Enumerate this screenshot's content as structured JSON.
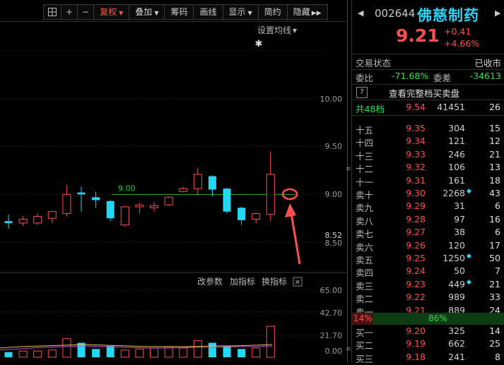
{
  "toolbar": {
    "buttons": [
      "复权",
      "叠加",
      "筹码",
      "画线",
      "显示",
      "简约",
      "隐藏"
    ]
  },
  "chart": {
    "setting_ma": "设置均线",
    "price_axis": [
      "10.00",
      "9.50",
      "9.00",
      "8.50"
    ],
    "current_label": "8.52",
    "line_label": "9.00",
    "sub_links": [
      "改参数",
      "加指标",
      "换指标"
    ],
    "sub_axis": [
      "65.00",
      "42.70",
      "21.70",
      "0.00"
    ]
  },
  "chart_data": {
    "type": "candlestick",
    "price_range": [
      8.25,
      10.25
    ],
    "reference_line": 9.0,
    "candles": [
      {
        "o": 8.7,
        "c": 8.72,
        "h": 8.79,
        "l": 8.64,
        "up": false
      },
      {
        "o": 8.7,
        "c": 8.74,
        "h": 8.77,
        "l": 8.67,
        "up": true
      },
      {
        "o": 8.7,
        "c": 8.77,
        "h": 8.8,
        "l": 8.68,
        "up": true
      },
      {
        "o": 8.75,
        "c": 8.82,
        "h": 8.83,
        "l": 8.7,
        "up": true
      },
      {
        "o": 8.8,
        "c": 9.0,
        "h": 9.1,
        "l": 8.77,
        "up": true
      },
      {
        "o": 9.0,
        "c": 9.02,
        "h": 9.08,
        "l": 8.82,
        "up": false
      },
      {
        "o": 8.97,
        "c": 8.94,
        "h": 9.03,
        "l": 8.86,
        "up": false
      },
      {
        "o": 8.93,
        "c": 8.75,
        "h": 8.94,
        "l": 8.72,
        "up": false
      },
      {
        "o": 8.68,
        "c": 8.87,
        "h": 8.88,
        "l": 8.66,
        "up": true
      },
      {
        "o": 8.87,
        "c": 8.89,
        "h": 8.91,
        "l": 8.8,
        "up": true
      },
      {
        "o": 8.86,
        "c": 8.88,
        "h": 8.92,
        "l": 8.82,
        "up": true
      },
      {
        "o": 8.89,
        "c": 8.97,
        "h": 8.98,
        "l": 8.88,
        "up": true
      },
      {
        "o": 9.03,
        "c": 9.06,
        "h": 9.08,
        "l": 9.02,
        "up": true
      },
      {
        "o": 9.06,
        "c": 9.21,
        "h": 9.28,
        "l": 8.99,
        "up": true
      },
      {
        "o": 9.19,
        "c": 9.05,
        "h": 9.2,
        "l": 8.98,
        "up": false
      },
      {
        "o": 9.06,
        "c": 8.82,
        "h": 9.07,
        "l": 8.8,
        "up": false
      },
      {
        "o": 8.86,
        "c": 8.73,
        "h": 8.87,
        "l": 8.68,
        "up": false
      },
      {
        "o": 8.74,
        "c": 8.8,
        "h": 8.81,
        "l": 8.7,
        "up": true
      },
      {
        "o": 8.79,
        "c": 9.21,
        "h": 9.45,
        "l": 8.72,
        "up": true
      }
    ],
    "volumes": [
      5,
      6,
      6,
      7,
      18,
      14,
      8,
      11,
      7,
      8,
      9,
      10,
      9,
      16,
      14,
      11,
      8,
      9,
      30
    ]
  },
  "quote": {
    "code": "002644",
    "name": "佛慈制药",
    "price": "9.21",
    "change": "+0.41",
    "pct": "+4.66%",
    "status_label": "交易状态",
    "status": "已收市",
    "wb_label": "委比",
    "wb": "-71.68%",
    "wc_label": "委差",
    "wc": "-34613",
    "depth_link": "查看完整档买卖盘",
    "total_label": "共48档",
    "total_price": "9.54",
    "total_vol": "41451",
    "total_cnt": "26",
    "sells": [
      {
        "label": "十五",
        "price": "9.35",
        "vol": "304",
        "cnt": "15",
        "dot": false
      },
      {
        "label": "十四",
        "price": "9.34",
        "vol": "121",
        "cnt": "12",
        "dot": false
      },
      {
        "label": "十三",
        "price": "9.33",
        "vol": "246",
        "cnt": "21",
        "dot": false
      },
      {
        "label": "十二",
        "price": "9.32",
        "vol": "106",
        "cnt": "13",
        "dot": false
      },
      {
        "label": "十一",
        "price": "9.31",
        "vol": "161",
        "cnt": "18",
        "dot": false
      },
      {
        "label": "卖十",
        "price": "9.30",
        "vol": "2268",
        "cnt": "43",
        "dot": true
      },
      {
        "label": "卖九",
        "price": "9.29",
        "vol": "31",
        "cnt": "6",
        "dot": false
      },
      {
        "label": "卖八",
        "price": "9.28",
        "vol": "97",
        "cnt": "16",
        "dot": false
      },
      {
        "label": "卖七",
        "price": "9.27",
        "vol": "38",
        "cnt": "6",
        "dot": false
      },
      {
        "label": "卖六",
        "price": "9.26",
        "vol": "120",
        "cnt": "17",
        "dot": false
      },
      {
        "label": "卖五",
        "price": "9.25",
        "vol": "1250",
        "cnt": "50",
        "dot": true
      },
      {
        "label": "卖四",
        "price": "9.24",
        "vol": "50",
        "cnt": "7",
        "dot": false
      },
      {
        "label": "卖三",
        "price": "9.23",
        "vol": "449",
        "cnt": "21",
        "dot": true
      },
      {
        "label": "卖二",
        "price": "9.22",
        "vol": "989",
        "cnt": "33",
        "dot": false
      },
      {
        "label": "卖一",
        "price": "9.21",
        "vol": "889",
        "cnt": "24",
        "dot": false
      }
    ],
    "ratio_left": "14%",
    "ratio_right": "86%",
    "ratio_left_frac": 0.14,
    "buys": [
      {
        "label": "买一",
        "price": "9.20",
        "vol": "325",
        "cnt": "14",
        "dot": false
      },
      {
        "label": "买二",
        "price": "9.19",
        "vol": "662",
        "cnt": "25",
        "dot": false
      },
      {
        "label": "买三",
        "price": "9.18",
        "vol": "241",
        "cnt": "8",
        "dot": false
      }
    ]
  }
}
